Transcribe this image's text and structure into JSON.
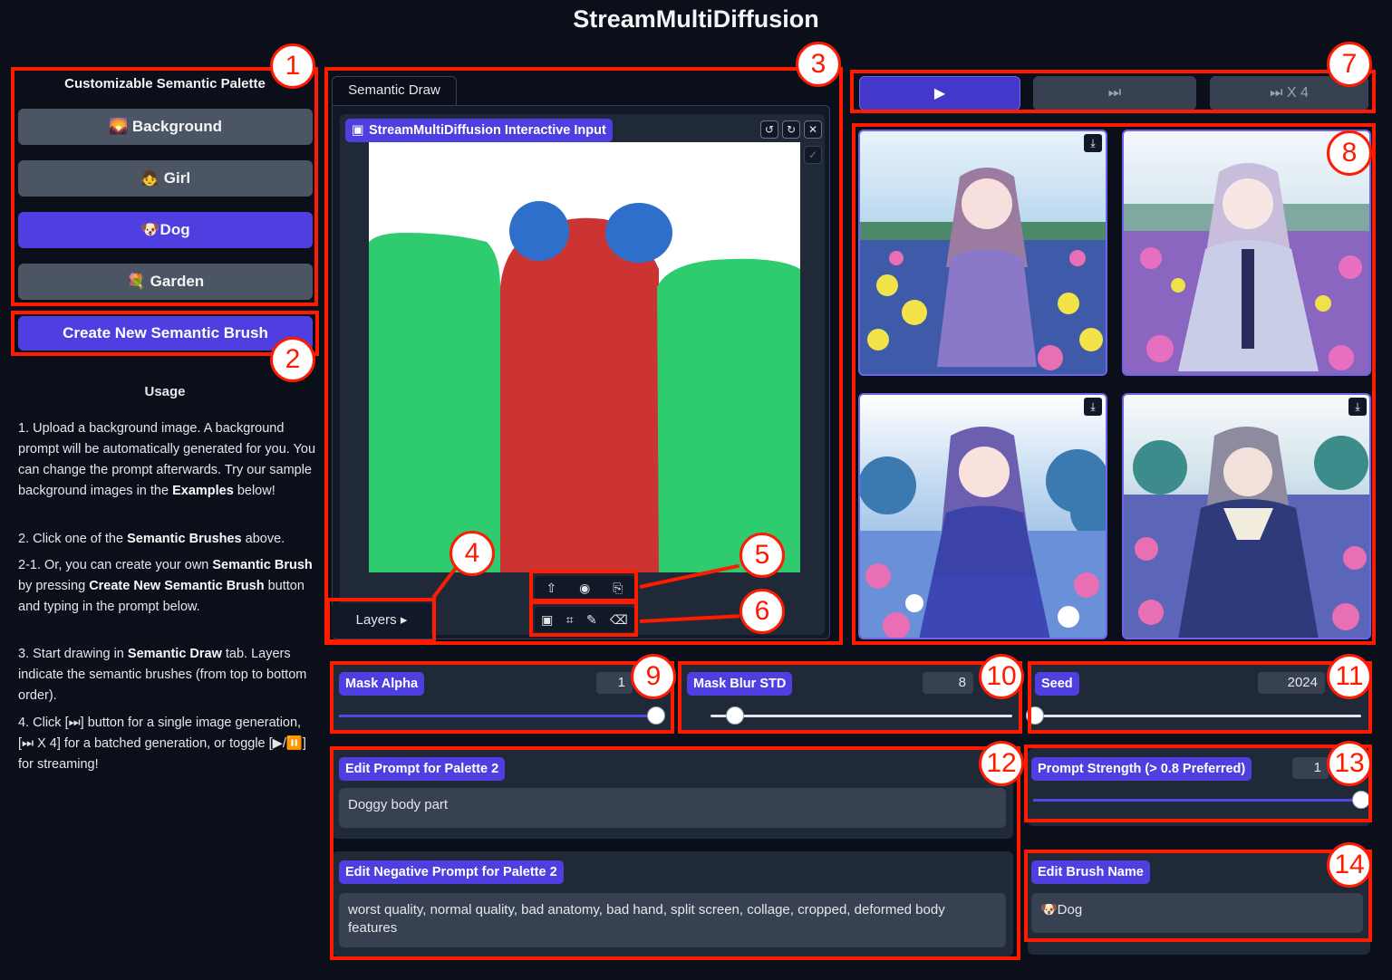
{
  "app": {
    "title": "StreamMultiDiffusion"
  },
  "palette": {
    "title": "Customizable Semantic Palette",
    "brushes": [
      {
        "label": "🌄 Background",
        "active": false
      },
      {
        "label": "👧 Girl",
        "active": false
      },
      {
        "label": "🐶Dog",
        "active": true
      },
      {
        "label": "💐 Garden",
        "active": false
      }
    ],
    "create_label": "Create New Semantic Brush"
  },
  "usage": {
    "title": "Usage",
    "p1_a": "1. Upload a background image. A background prompt will be automatically generated for you. You can change the prompt afterwards. Try our sample background images in the ",
    "p1_b": "Examples",
    "p1_c": " below!",
    "p2_a": "2. Click one of the ",
    "p2_b": "Semantic Brushes",
    "p2_c": " above.",
    "p3_a": "2-1. Or, you can create your own ",
    "p3_b": "Semantic Brush",
    "p3_c": " by pressing ",
    "p3_d": "Create New Semantic Brush",
    "p3_e": " button and typing in the prompt below.",
    "p4_a": "3. Start drawing in ",
    "p4_b": "Semantic Draw",
    "p4_c": " tab. Layers indicate the semantic brushes (from top to bottom order).",
    "p5": "4. Click [⏭] button for a single image generation, [⏭ X 4] for a batched generation, or toggle [▶/⏸️] for streaming!"
  },
  "editor": {
    "tab": "Semantic Draw",
    "label": "StreamMultiDiffusion Interactive Input",
    "layers": "Layers"
  },
  "controls": {
    "play": "▶",
    "step": "⏭",
    "batch": "⏭ X 4"
  },
  "sliders": {
    "mask_alpha": {
      "label": "Mask Alpha",
      "value": "1",
      "fraction": 1.0
    },
    "mask_blur": {
      "label": "Mask Blur STD",
      "value": "8",
      "fraction": 0.08
    },
    "seed": {
      "label": "Seed",
      "value": "2024",
      "fraction": 0.0
    },
    "prompt_strength": {
      "label": "Prompt Strength (> 0.8 Preferred)",
      "value": "1",
      "fraction": 1.0
    }
  },
  "prompt": {
    "label": "Edit Prompt for Palette 2",
    "value": "Doggy body part",
    "neg_label": "Edit Negative Prompt for Palette 2",
    "neg_value": "worst quality, normal quality, bad anatomy, bad hand, split screen, collage, cropped, deformed body features"
  },
  "brush_name": {
    "label": "Edit Brush Name",
    "value": "🐶Dog"
  },
  "callouts": [
    "1",
    "2",
    "3",
    "4",
    "5",
    "6",
    "7",
    "8",
    "9",
    "10",
    "11",
    "12",
    "13",
    "14"
  ],
  "colors": {
    "accent": "#4f3fe0",
    "annotation": "#ff1a00",
    "bg": "#0b0f19"
  }
}
